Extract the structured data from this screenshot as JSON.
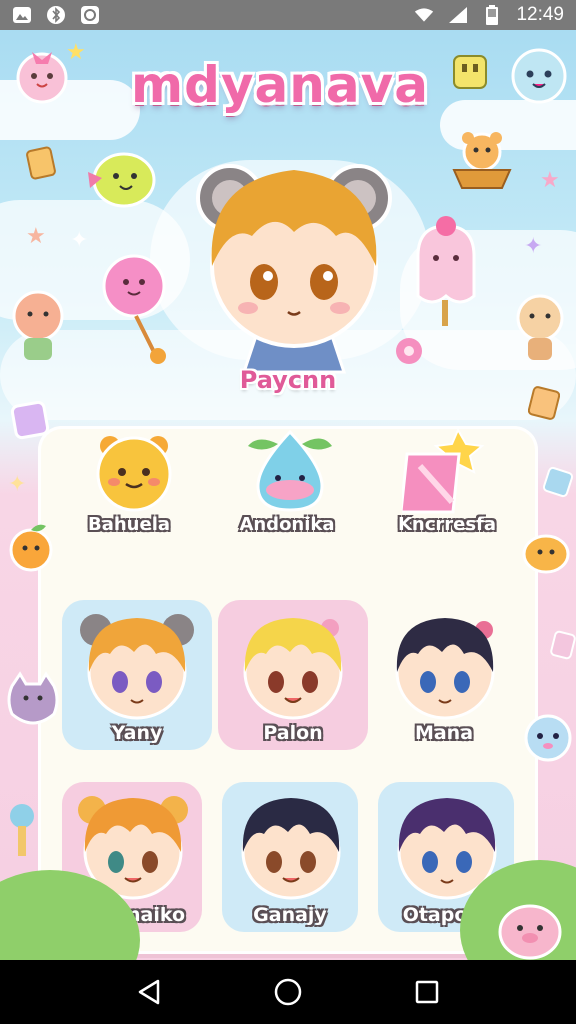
{
  "status_bar": {
    "time": "12:49",
    "left_icons": [
      "gallery-icon",
      "bluetooth-icon",
      "sync-icon"
    ],
    "right_icons": [
      "wifi-icon",
      "cellular-signal-icon",
      "battery-icon"
    ]
  },
  "app": {
    "title": "mdyanava",
    "hero": {
      "name": "Paycnn"
    }
  },
  "featured": [
    {
      "label": "Bahuela"
    },
    {
      "label": "Andonika"
    },
    {
      "label": "Kncrresfa"
    }
  ],
  "characters": [
    {
      "label": "Yany",
      "style": "blue"
    },
    {
      "label": "Palon",
      "style": "pink"
    },
    {
      "label": "Mana",
      "style": "pink"
    },
    {
      "label": "Bingnaiko",
      "style": "pink"
    },
    {
      "label": "Ganajy",
      "style": "blue"
    },
    {
      "label": "Otapota",
      "style": "blue"
    }
  ],
  "nav_bar": {
    "buttons": [
      "back-icon",
      "home-icon",
      "recents-icon"
    ]
  },
  "colors": {
    "title": "#f06aa9",
    "panel": "#fdfbf2",
    "card_blue": "#cfeaf7",
    "card_pink": "#f6cde0",
    "status_bar": "#7a7a7a",
    "nav_bar": "#000000"
  }
}
